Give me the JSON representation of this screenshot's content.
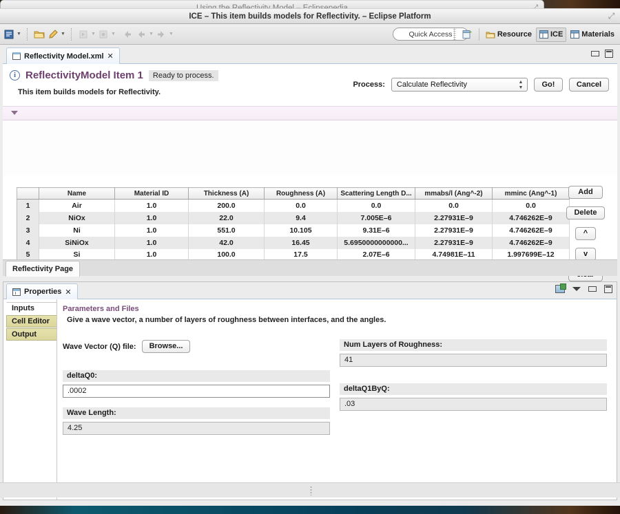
{
  "background_window": {
    "title": "Using the Reflectivity Model – Eclipsepedia"
  },
  "window": {
    "title": "ICE – This item builds models for Reflectivity. – Eclipse Platform"
  },
  "toolbar": {
    "quick_access": "Quick Access",
    "icons": [
      "editor-icon",
      "open-folder-icon",
      "pencil-icon",
      "launch-icon",
      "debug-icon",
      "back-icon",
      "back-alt-icon",
      "forward-icon"
    ],
    "perspective": {
      "open_perspective_icon": "open-perspective-icon",
      "items": [
        {
          "label": "Resource",
          "icon": "resource-perspective-icon",
          "active": false
        },
        {
          "label": "ICE",
          "icon": "ice-perspective-icon",
          "active": true
        },
        {
          "label": "Materials",
          "icon": "materials-perspective-icon",
          "active": false
        }
      ]
    }
  },
  "editor": {
    "tab": {
      "label": "Reflectivity Model.xml",
      "icon": "xml-file-icon",
      "close": "✕"
    },
    "header": {
      "title": "ReflectivityModel Item 1",
      "status": "Ready to process.",
      "description": "This item builds models for Reflectivity."
    },
    "process": {
      "label": "Process:",
      "selected": "Calculate Reflectivity",
      "options": [
        "Calculate Reflectivity"
      ],
      "go_label": "Go!",
      "cancel_label": "Cancel"
    },
    "page_tab": "Reflectivity Page"
  },
  "table": {
    "columns": [
      "",
      "Name",
      "Material ID",
      "Thickness (A)",
      "Roughness (A)",
      "Scattering Length D...",
      "mmabs/l (Ang^-2)",
      "mminc (Ang^-1)"
    ],
    "rows": [
      {
        "num": "1",
        "cells": [
          "Air",
          "1.0",
          "200.0",
          "0.0",
          "0.0",
          "0.0",
          "0.0"
        ]
      },
      {
        "num": "2",
        "cells": [
          "NiOx",
          "1.0",
          "22.0",
          "9.4",
          "7.005E–6",
          "2.27931E–9",
          "4.746262E–9"
        ]
      },
      {
        "num": "3",
        "cells": [
          "Ni",
          "1.0",
          "551.0",
          "10.105",
          "9.31E–6",
          "2.27931E–9",
          "4.746262E–9"
        ]
      },
      {
        "num": "4",
        "cells": [
          "SiNiOx",
          "1.0",
          "42.0",
          "16.45",
          "5.6950000000000...",
          "2.27931E–9",
          "4.746262E–9"
        ]
      },
      {
        "num": "5",
        "cells": [
          "Si",
          "1.0",
          "100.0",
          "17.5",
          "2.07E–6",
          "4.74981E–11",
          "1.997699E–12"
        ]
      }
    ],
    "buttons": [
      {
        "label": "Add",
        "name": "add-row-button"
      },
      {
        "label": "Delete",
        "name": "delete-row-button"
      },
      {
        "label": "^",
        "name": "move-up-button"
      },
      {
        "label": "v",
        "name": "move-down-button"
      },
      {
        "label": "clear",
        "name": "clear-table-button"
      }
    ]
  },
  "properties": {
    "tab": {
      "label": "Properties",
      "icon": "properties-icon",
      "close": "✕"
    },
    "toolbar_icons": [
      "new-view-icon",
      "view-menu-icon",
      "minimize-icon",
      "maximize-icon"
    ],
    "side_tabs": [
      {
        "label": "Inputs",
        "active": true
      },
      {
        "label": "Cell Editor",
        "active": false
      },
      {
        "label": "Output",
        "active": false
      }
    ],
    "panel": {
      "title": "Parameters and Files",
      "subtitle": "Give a wave vector, a number of layers of roughness between interfaces, and the angles."
    },
    "fields": {
      "wave_vector_label": "Wave Vector (Q) file:",
      "browse_label": "Browse...",
      "num_layers_label": "Num Layers of Roughness:",
      "num_layers_value": "41",
      "deltaq0_label": "deltaQ0:",
      "deltaq0_value": ".0002",
      "deltaq1byq_label": "deltaQ1ByQ:",
      "deltaq1byq_value": ".03",
      "wavelength_label": "Wave Length:",
      "wavelength_value": "4.25"
    }
  },
  "colors": {
    "accent_purple": "#6d3f6d",
    "tab_blue": "#b0c4de",
    "side_tab_khaki": "#dbd69b",
    "field_gray": "#e9e9e9"
  }
}
